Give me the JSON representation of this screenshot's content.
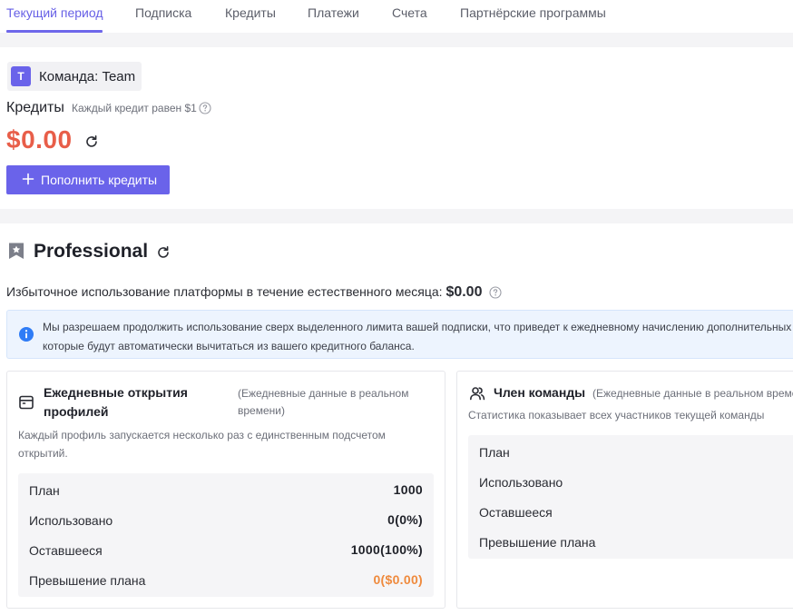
{
  "tabs": [
    {
      "label": "Текущий период",
      "active": true
    },
    {
      "label": "Подписка"
    },
    {
      "label": "Кредиты"
    },
    {
      "label": "Платежи"
    },
    {
      "label": "Счета"
    },
    {
      "label": "Партнёрские программы"
    }
  ],
  "team": {
    "avatar_letter": "T",
    "label": "Команда: Team"
  },
  "credits": {
    "title": "Кредиты",
    "hint": "Каждый кредит равен $1",
    "balance": "$0.00",
    "topup_label": "Пополнить кредиты"
  },
  "plan": {
    "name": "Professional",
    "overuse_label": "Избыточное использование платформы в течение естественного месяца:",
    "overuse_value": "$0.00",
    "notice": "Мы разрешаем продолжить использование сверх выделенного лимита вашей подписки, что приведет к ежедневному начислению дополнительных средств, которые будут автоматически вычитаться из вашего кредитного баланса."
  },
  "daily_opens": {
    "title": "Ежедневные открытия профилей",
    "subtitle": "(Ежедневные данные в реальном времени)",
    "description": "Каждый профиль запускается несколько раз с единственным подсчетом открытий.",
    "rows": [
      {
        "key": "План",
        "value": "1000"
      },
      {
        "key": "Использовано",
        "value": "0(0%)"
      },
      {
        "key": "Оставшееся",
        "value": "1000(100%)"
      },
      {
        "key": "Превышение плана",
        "value": "0($0.00)"
      }
    ]
  },
  "team_members": {
    "title": "Член команды",
    "subtitle": "(Ежедневные данные в реальном времени)",
    "description": "Статистика показывает всех участников текущей команды",
    "rows": [
      {
        "key": "План"
      },
      {
        "key": "Использовано"
      },
      {
        "key": "Оставшееся"
      },
      {
        "key": "Превышение плана"
      }
    ]
  },
  "colors": {
    "accent": "#6a63ea",
    "balance": "#e85e49",
    "overage": "#ef8a3d",
    "notice_bg": "#edf4fe",
    "info_icon": "#2f7cf6"
  },
  "icons": {
    "help": "question-circle-icon",
    "refresh": "refresh-icon",
    "plus": "plus-icon",
    "plan_badge": "star-bookmark-icon",
    "info": "info-circle-icon",
    "calendar": "calendar-icon",
    "users": "users-icon"
  }
}
